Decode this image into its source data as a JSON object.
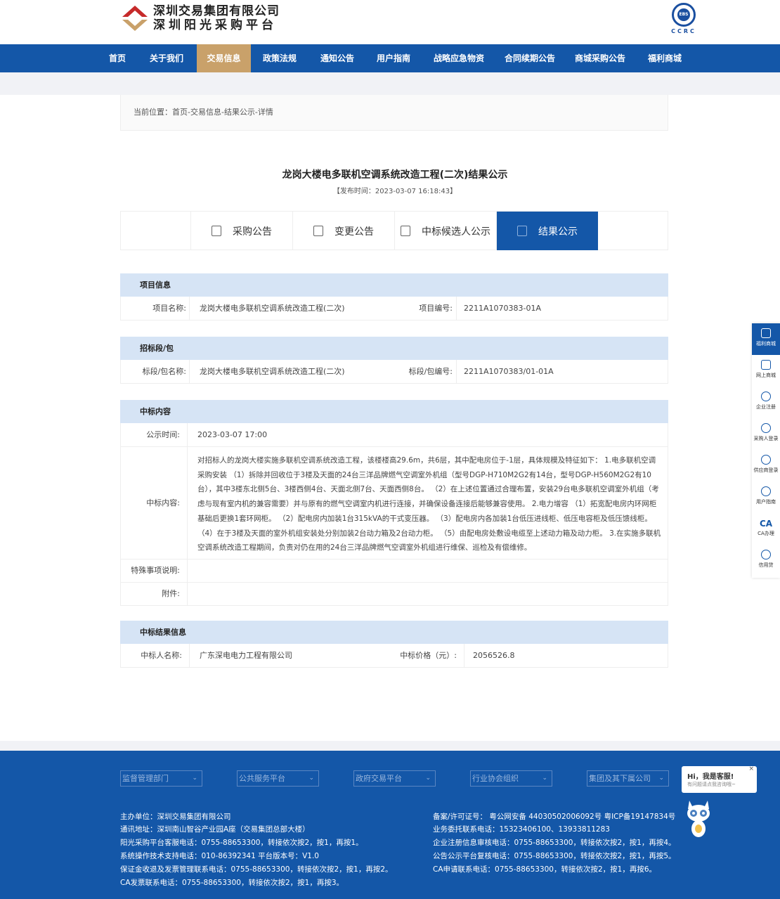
{
  "header": {
    "logo_line1": "深圳交易集团有限公司",
    "logo_line2": "深圳阳光采购平台",
    "ccrc_badge": "EBS",
    "ccrc_text": "CCRC"
  },
  "nav": {
    "items": [
      "首页",
      "关于我们",
      "交易信息",
      "政策法规",
      "通知公告",
      "用户指南",
      "战略应急物资",
      "合同续期公告",
      "商城采购公告",
      "福利商城"
    ],
    "active_index": 2
  },
  "breadcrumb": "当前位置：首页-交易信息-结果公示-详情",
  "title": "龙岗大楼电多联机空调系统改造工程(二次)结果公示",
  "publish_time": "【发布时间：2023-03-07 16:18:43】",
  "tabs": [
    "采购公告",
    "变更公告",
    "中标候选人公示",
    "结果公示"
  ],
  "project_info": {
    "heading": "项目信息",
    "name_label": "项目名称:",
    "name_value": "龙岗大楼电多联机空调系统改造工程(二次)",
    "code_label": "项目编号:",
    "code_value": "2211A1070383-01A"
  },
  "lot_info": {
    "heading": "招标段/包",
    "name_label": "标段/包名称:",
    "name_value": "龙岗大楼电多联机空调系统改造工程(二次)",
    "code_label": "标段/包编号:",
    "code_value": "2211A1070383/01-01A"
  },
  "award": {
    "heading": "中标内容",
    "time_label": "公示时间:",
    "time_value": "2023-03-07 17:00",
    "content_label": "中标内容:",
    "content_value": "对招标人的龙岗大楼实施多联机空调系统改造工程，该楼楼高29.6m，共6层，其中配电房位于-1层，具体规模及特征如下： 1.电多联机空调采购安装 （1）拆除并回收位于3楼及天面的24台三洋品牌燃气空调室外机组（型号DGP-H710M2G2有14台，型号DGP-H560M2G2有10台），其中3楼东北侧5台、3楼西侧4台、天面北侧7台、天面西侧8台。 （2）在上述位置通过合理布置，安装29台电多联机空调室外机组（考虑与现有室内机的兼容需要）并与原有的燃气空调室内机进行连接，并确保设备连接后能够兼容使用。 2.电力增容 （1）拓宽配电房内环网柜基础后更换1套环网柜。 （2）配电房内加装1台315kVA的干式变压器。 （3）配电房内各加装1台低压进线柜、低压电容柜及低压馈线柜。 （4）在于3楼及天面的室外机组安装处分别加装2台动力箱及2台动力柜。 （5）由配电房处敷设电缆至上述动力箱及动力柜。 3.在实施多联机空调系统改造工程期间，负责对仍在用的24台三洋品牌燃气空调室外机组进行维保、巡检及有偿维修。",
    "special_label": "特殊事项说明:",
    "special_value": "",
    "attach_label": "附件:",
    "attach_value": ""
  },
  "result": {
    "heading": "中标结果信息",
    "winner_label": "中标人名称:",
    "winner_value": "广东深电电力工程有限公司",
    "price_label": "中标价格（元）:",
    "price_value": "2056526.8"
  },
  "sidebar": [
    "福利商城",
    "网上商城",
    "企业注册",
    "采购人登录",
    "供应商登录",
    "用户指南",
    "CA办理",
    "信用贷"
  ],
  "sidebar_ca": "CA",
  "footer": {
    "selects": [
      "监督管理部门",
      "公共服务平台",
      "政府交易平台",
      "行业协会组织",
      "集团及其下属公司"
    ],
    "left_lines": [
      "主办单位：深圳交易集团有限公司",
      "通讯地址：深圳南山智谷产业园A座（交易集团总部大楼）",
      "阳光采购平台客服电话：0755-88653300，转接依次按2，按1，再按1。",
      "系统操作技术支持电话：010-86392341 平台版本号：V1.0",
      "保证金收退及发票管理联系电话：0755-88653300，转接依次按2，按1，再按2。",
      "CA发票联系电话：0755-88653300，转接依次按2，按1，再按3。"
    ],
    "right_lines": [
      "备案/许可证号： 粤公网安备 44030502006092号 粤ICP备19147834号",
      "业务委托联系电话：15323406100、13933811283",
      "企业注册信息审核电话：0755-88653300，转接依次按2，按1，再按4。",
      "公告公示平台复核电话：0755-88653300，转接依次按2，按1，再按5。",
      "CA申请联系电话：0755-88653300，转接依次按2，按1，再按6。"
    ],
    "kefu_title": "Hi，我是客服!",
    "kefu_sub": "有问题请点我咨询哦~",
    "kefu_close": "×"
  },
  "colors": {
    "brand": "#1457a8",
    "active_nav": "#c9a16a",
    "section_head": "#d6e4f5"
  }
}
